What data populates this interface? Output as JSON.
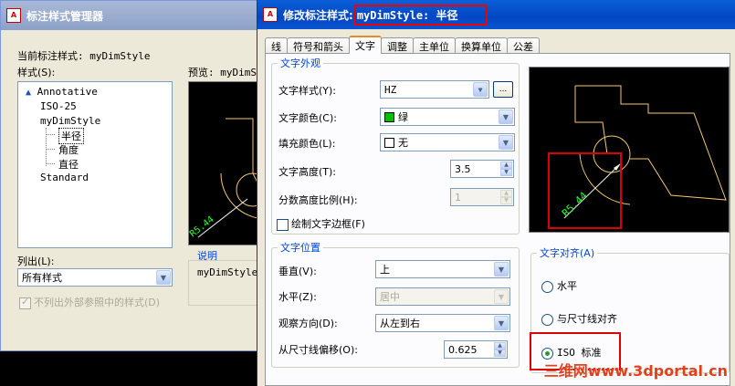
{
  "background_window": {
    "title": "标注样式管理器",
    "current_style_label": "当前标注样式: myDimStyle",
    "styles_label": "样式(S):",
    "styles": [
      {
        "label": "Annotative",
        "annotative_icon": true
      },
      {
        "label": "ISO-25"
      },
      {
        "label": "myDimStyle"
      },
      {
        "label": "半径"
      },
      {
        "label": "角度"
      },
      {
        "label": "直径"
      },
      {
        "label": "Standard"
      }
    ],
    "preview_label": "预览: myDimSt",
    "list_label": "列出(L):",
    "list_value": "所有样式",
    "exclude_xref_label": "不列出外部参照中的样式(D)",
    "description_label": "说明",
    "description_value": "myDimStyle",
    "preview_dimension_text": "R5.44"
  },
  "dialog": {
    "title_prefix": "修改标注样式:",
    "title_style": "myDimStyle: 半径",
    "tabs": [
      "线",
      "符号和箭头",
      "文字",
      "调整",
      "主单位",
      "换算单位",
      "公差"
    ],
    "active_tab": "文字",
    "text_appearance": {
      "legend": "文字外观",
      "text_style_label": "文字样式(Y):",
      "text_style_value": "HZ",
      "browse_label": "...",
      "text_color_label": "文字颜色(C):",
      "text_color_value": "绿",
      "text_color_swatch": "#00c000",
      "fill_color_label": "填充颜色(L):",
      "fill_color_value": "无",
      "text_height_label": "文字高度(T):",
      "text_height_value": "3.5",
      "fraction_scale_label": "分数高度比例(H):",
      "fraction_scale_value": "1",
      "draw_frame_label": "绘制文字边框(F)"
    },
    "text_placement": {
      "legend": "文字位置",
      "vertical_label": "垂直(V):",
      "vertical_value": "上",
      "horizontal_label": "水平(Z):",
      "horizontal_value": "居中",
      "view_direction_label": "观察方向(D):",
      "view_direction_value": "从左到右",
      "offset_label": "从尺寸线偏移(O):",
      "offset_value": "0.625"
    },
    "text_alignment": {
      "legend": "文字对齐(A)",
      "options": [
        "水平",
        "与尺寸线对齐",
        "ISO 标准"
      ],
      "selected": "ISO 标准"
    },
    "preview_dimension_text": "R5.44"
  },
  "watermark": "三维网www.3dportal.cn",
  "colors": {
    "title_active": "#0a5fd8",
    "title_inactive": "#8da1c8",
    "highlight_red": "#dd0000",
    "group_legend": "#0046d5",
    "preview_geometry": "#f2c879",
    "preview_dimension": "#33ff33"
  }
}
